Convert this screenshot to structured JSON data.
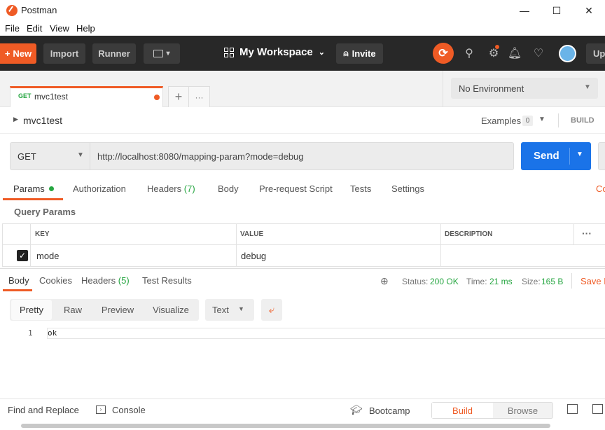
{
  "window": {
    "title": "Postman",
    "minimize": "—",
    "maximize": "☐",
    "close": "✕"
  },
  "menu": [
    "File",
    "Edit",
    "View",
    "Help"
  ],
  "header": {
    "new_label": "New",
    "import_label": "Import",
    "runner_label": "Runner",
    "workspace_label": "My Workspace",
    "invite_label": "Invite",
    "upgrade_label": "Up"
  },
  "tab": {
    "method": "GET",
    "name": "mvc1test"
  },
  "environment": {
    "selected": "No Environment"
  },
  "request": {
    "name": "mvc1test",
    "examples_label": "Examples",
    "examples_count": "0",
    "build_label": "BUILD",
    "method": "GET",
    "url": "http://localhost:8080/mapping-param?mode=debug",
    "send_label": "Send"
  },
  "request_tabs": {
    "params": "Params",
    "authorization": "Authorization",
    "headers": "Headers",
    "headers_count": "(7)",
    "body": "Body",
    "prerequest": "Pre-request Script",
    "tests": "Tests",
    "settings": "Settings",
    "cookies_partial": "Co"
  },
  "query_params": {
    "title": "Query Params",
    "col_key": "KEY",
    "col_value": "VALUE",
    "col_description": "DESCRIPTION",
    "rows": [
      {
        "key": "mode",
        "value": "debug",
        "description": "",
        "checked": true
      }
    ]
  },
  "response": {
    "tabs": {
      "body": "Body",
      "cookies": "Cookies",
      "headers": "Headers",
      "headers_count": "(5)",
      "test_results": "Test Results"
    },
    "status_label": "Status:",
    "status_value": "200 OK",
    "time_label": "Time:",
    "time_value": "21 ms",
    "size_label": "Size:",
    "size_value": "165 B",
    "save_partial": "Save R",
    "view_modes": {
      "pretty": "Pretty",
      "raw": "Raw",
      "preview": "Preview",
      "visualize": "Visualize"
    },
    "format": "Text",
    "line_number": "1",
    "body_text": "ok"
  },
  "footer": {
    "find_replace": "Find and Replace",
    "console": "Console",
    "bootcamp": "Bootcamp",
    "build": "Build",
    "browse": "Browse"
  },
  "colors": {
    "accent": "#ef5b25",
    "send": "#1a73e8",
    "header_bg": "#282828",
    "status_ok": "#26a641"
  }
}
